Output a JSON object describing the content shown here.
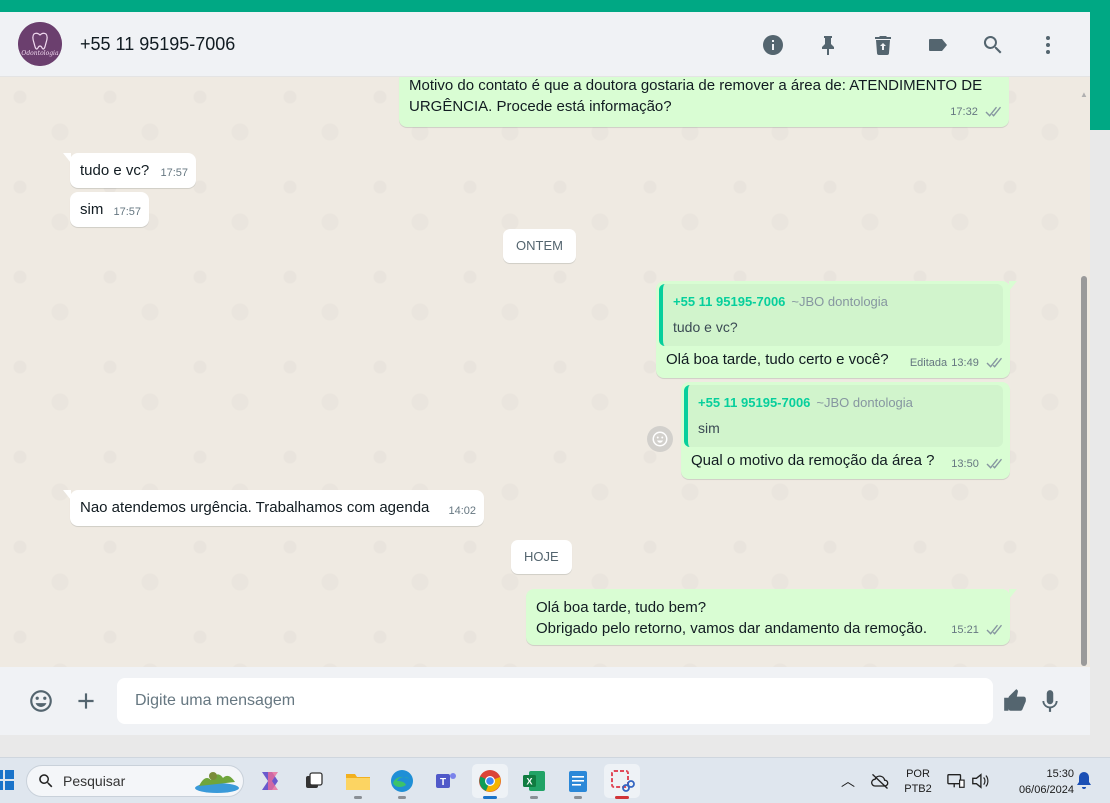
{
  "header": {
    "contact_name": "+55 11 95195-7006",
    "avatar_logo_text": "Odontologia",
    "icons": [
      "info-icon",
      "pin-icon",
      "delete-icon",
      "label-icon",
      "search-icon",
      "menu-icon"
    ]
  },
  "messages": {
    "m1": {
      "text_line1": "Motivo do contato é que a doutora gostaria de remover a área de: ATENDIMENTO DE",
      "text_line2": "URGÊNCIA. Procede está informação?",
      "time": "17:32"
    },
    "m2": {
      "text": "tudo e vc?",
      "time": "17:57"
    },
    "m3": {
      "text": "sim",
      "time": "17:57"
    },
    "date1": "ONTEM",
    "m4": {
      "quote_author": "+55 11 95195-7006",
      "quote_pushname": "~JBO dontologia",
      "quote_text": "tudo e vc?",
      "text": "Olá boa tarde, tudo certo e você?",
      "edited": "Editada",
      "time": "13:49"
    },
    "m5": {
      "quote_author": "+55 11 95195-7006",
      "quote_pushname": "~JBO dontologia",
      "quote_text": "sim",
      "text": "Qual o motivo da remoção da área ?",
      "time": "13:50"
    },
    "m6": {
      "text": "Nao atendemos urgência. Trabalhamos com agenda",
      "time": "14:02"
    },
    "date2": "HOJE",
    "m7": {
      "text_line1": "Olá boa tarde, tudo bem?",
      "text_line2": "Obrigado pelo retorno, vamos dar andamento da remoção.",
      "time": "15:21"
    }
  },
  "composer": {
    "placeholder": "Digite uma mensagem"
  },
  "taskbar": {
    "search_label": "Pesquisar",
    "lang_line1": "POR",
    "lang_line2": "PTB2",
    "time": "15:30",
    "date": "06/06/2024"
  },
  "colors": {
    "accent": "#00a884",
    "outgoing_bubble": "#d9fdd3",
    "incoming_bubble": "#ffffff",
    "chat_background": "#efeae2",
    "quote_author": "#06cf9c"
  }
}
